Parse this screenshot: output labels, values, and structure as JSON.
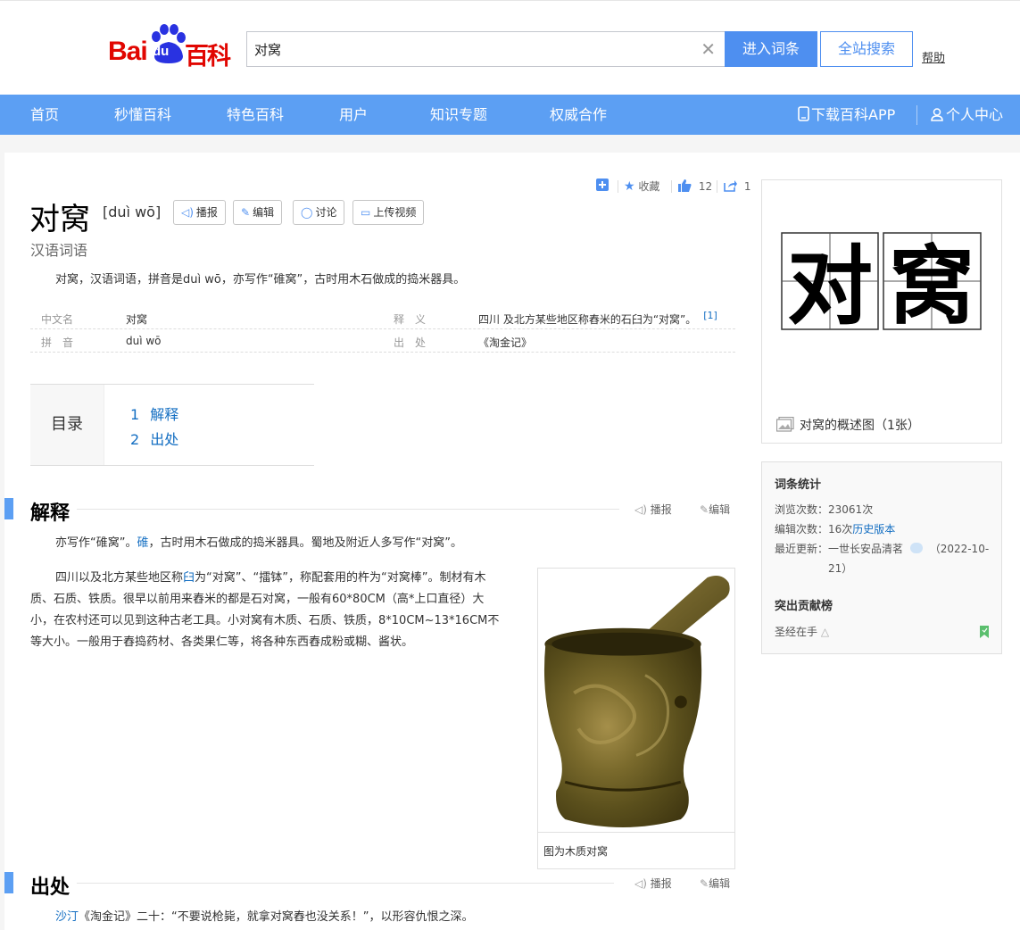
{
  "header": {
    "logo_bai": "Bai",
    "logo_du": "du",
    "logo_baike": "百科",
    "search_value": "对窝",
    "clear_icon": "close-icon",
    "enter_label": "进入词条",
    "all_search_label": "全站搜索",
    "help_label": "帮助"
  },
  "nav": {
    "items": [
      "首页",
      "秒懂百科",
      "特色百科",
      "用户",
      "知识专题",
      "权威合作"
    ],
    "download_app": "下载百科APP",
    "user_center": "个人中心"
  },
  "toolbar": {
    "favorite_label": "收藏",
    "like_count": "12",
    "share_count": "1"
  },
  "entry": {
    "title": "对窝",
    "pinyin": "[duì wō]",
    "btn_broadcast": "播报",
    "btn_edit": "编辑",
    "btn_discuss": "讨论",
    "btn_upload_video": "上传视频",
    "subtitle": "汉语词语",
    "summary": "对窝，汉语词语，拼音是duì wō，亦写作“碓窝”，古时用木石做成的捣米器具。"
  },
  "basic_info": [
    {
      "k1": "中文名",
      "v1": "对窝",
      "k2": "释　义",
      "v2": "四川 及北方某些地区称舂米的石臼为“对窝”。",
      "ref": "[1]"
    },
    {
      "k1": "拼　音",
      "v1": "duì wō",
      "k2": "出　处",
      "v2": "《淘金记》",
      "ref": ""
    }
  ],
  "toc": {
    "heading": "目录",
    "items": [
      {
        "num": "1",
        "label": "解释"
      },
      {
        "num": "2",
        "label": "出处"
      }
    ]
  },
  "section1": {
    "title": "解释",
    "broadcast": "播报",
    "edit": "编辑",
    "para1_a": "亦写作“碓窝”。",
    "para1_link": "碓",
    "para1_b": "，古时用木石做成的捣米器具。蜀地及附近人多写作“对窝”。",
    "para2_a": "四川以及北方某些地区称",
    "para2_link": "臼",
    "para2_b": "为“对窝”、“擂钵”，称配套用的杵为“对窝棒”。制材有木质、石质、铁质。很早以前用来舂米的都是石对窝，一般有60*80CM（高*上口直径）大小，在农村还可以见到这种古老工具。小对窝有木质、石质、铁质，8*10CM~13*16CM不等大小。一般用于舂捣药材、各类果仁等，将各种东西舂成粉或糊、酱状。",
    "figure_caption": "图为木质对窝"
  },
  "section2": {
    "title": "出处",
    "broadcast": "播报",
    "edit": "编辑",
    "para_link": "沙汀",
    "para_text": "《淘金记》二十：“不要说枪毙，就拿对窝舂也没关系！”，以形容仇恨之深。"
  },
  "side": {
    "image_chars": [
      "对",
      "窝"
    ],
    "image_caption": "对窝的概述图（1张）",
    "stats_title": "词条统计",
    "views_label": "浏览次数：",
    "views_value": "23061次",
    "edits_label": "编辑次数：",
    "edits_value": "16次",
    "history_link": "历史版本",
    "updated_label": "最近更新：",
    "updated_user": "一世长安品清茗",
    "updated_date_a": "（2022-10-",
    "updated_date_b": "21）",
    "contrib_title": "突出贡献榜",
    "contrib_user": "圣经在手"
  },
  "colors": {
    "brand_blue": "#5c9ff3",
    "button_blue": "#4e8ff0",
    "logo_red": "#e10601",
    "link": "#136ec2"
  }
}
